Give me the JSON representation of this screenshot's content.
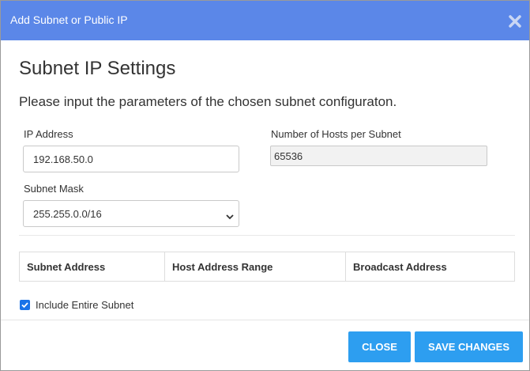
{
  "dialog": {
    "title": "Add Subnet or Public IP",
    "heading": "Subnet IP Settings",
    "subheading": "Please input the parameters of the chosen subnet configuraton."
  },
  "form": {
    "ip_label": "IP Address",
    "ip_value": "192.168.50.0",
    "mask_label": "Subnet Mask",
    "mask_value": "255.255.0.0/16",
    "hosts_label": "Number of Hosts per Subnet",
    "hosts_value": "65536"
  },
  "table": {
    "columns": [
      "Subnet Address",
      "Host Address Range",
      "Broadcast Address"
    ]
  },
  "options": {
    "include_entire_subnet_label": "Include Entire Subnet",
    "include_entire_subnet_checked": true
  },
  "buttons": {
    "close_label": "CLOSE",
    "save_label": "SAVE CHANGES"
  },
  "colors": {
    "titlebar": "#5b87e8",
    "button": "#2d9ef0",
    "checkbox": "#1a73e8"
  },
  "icons": {
    "close": "close-x-icon",
    "dropdown": "chevron-down-icon",
    "check": "checkmark-icon"
  }
}
